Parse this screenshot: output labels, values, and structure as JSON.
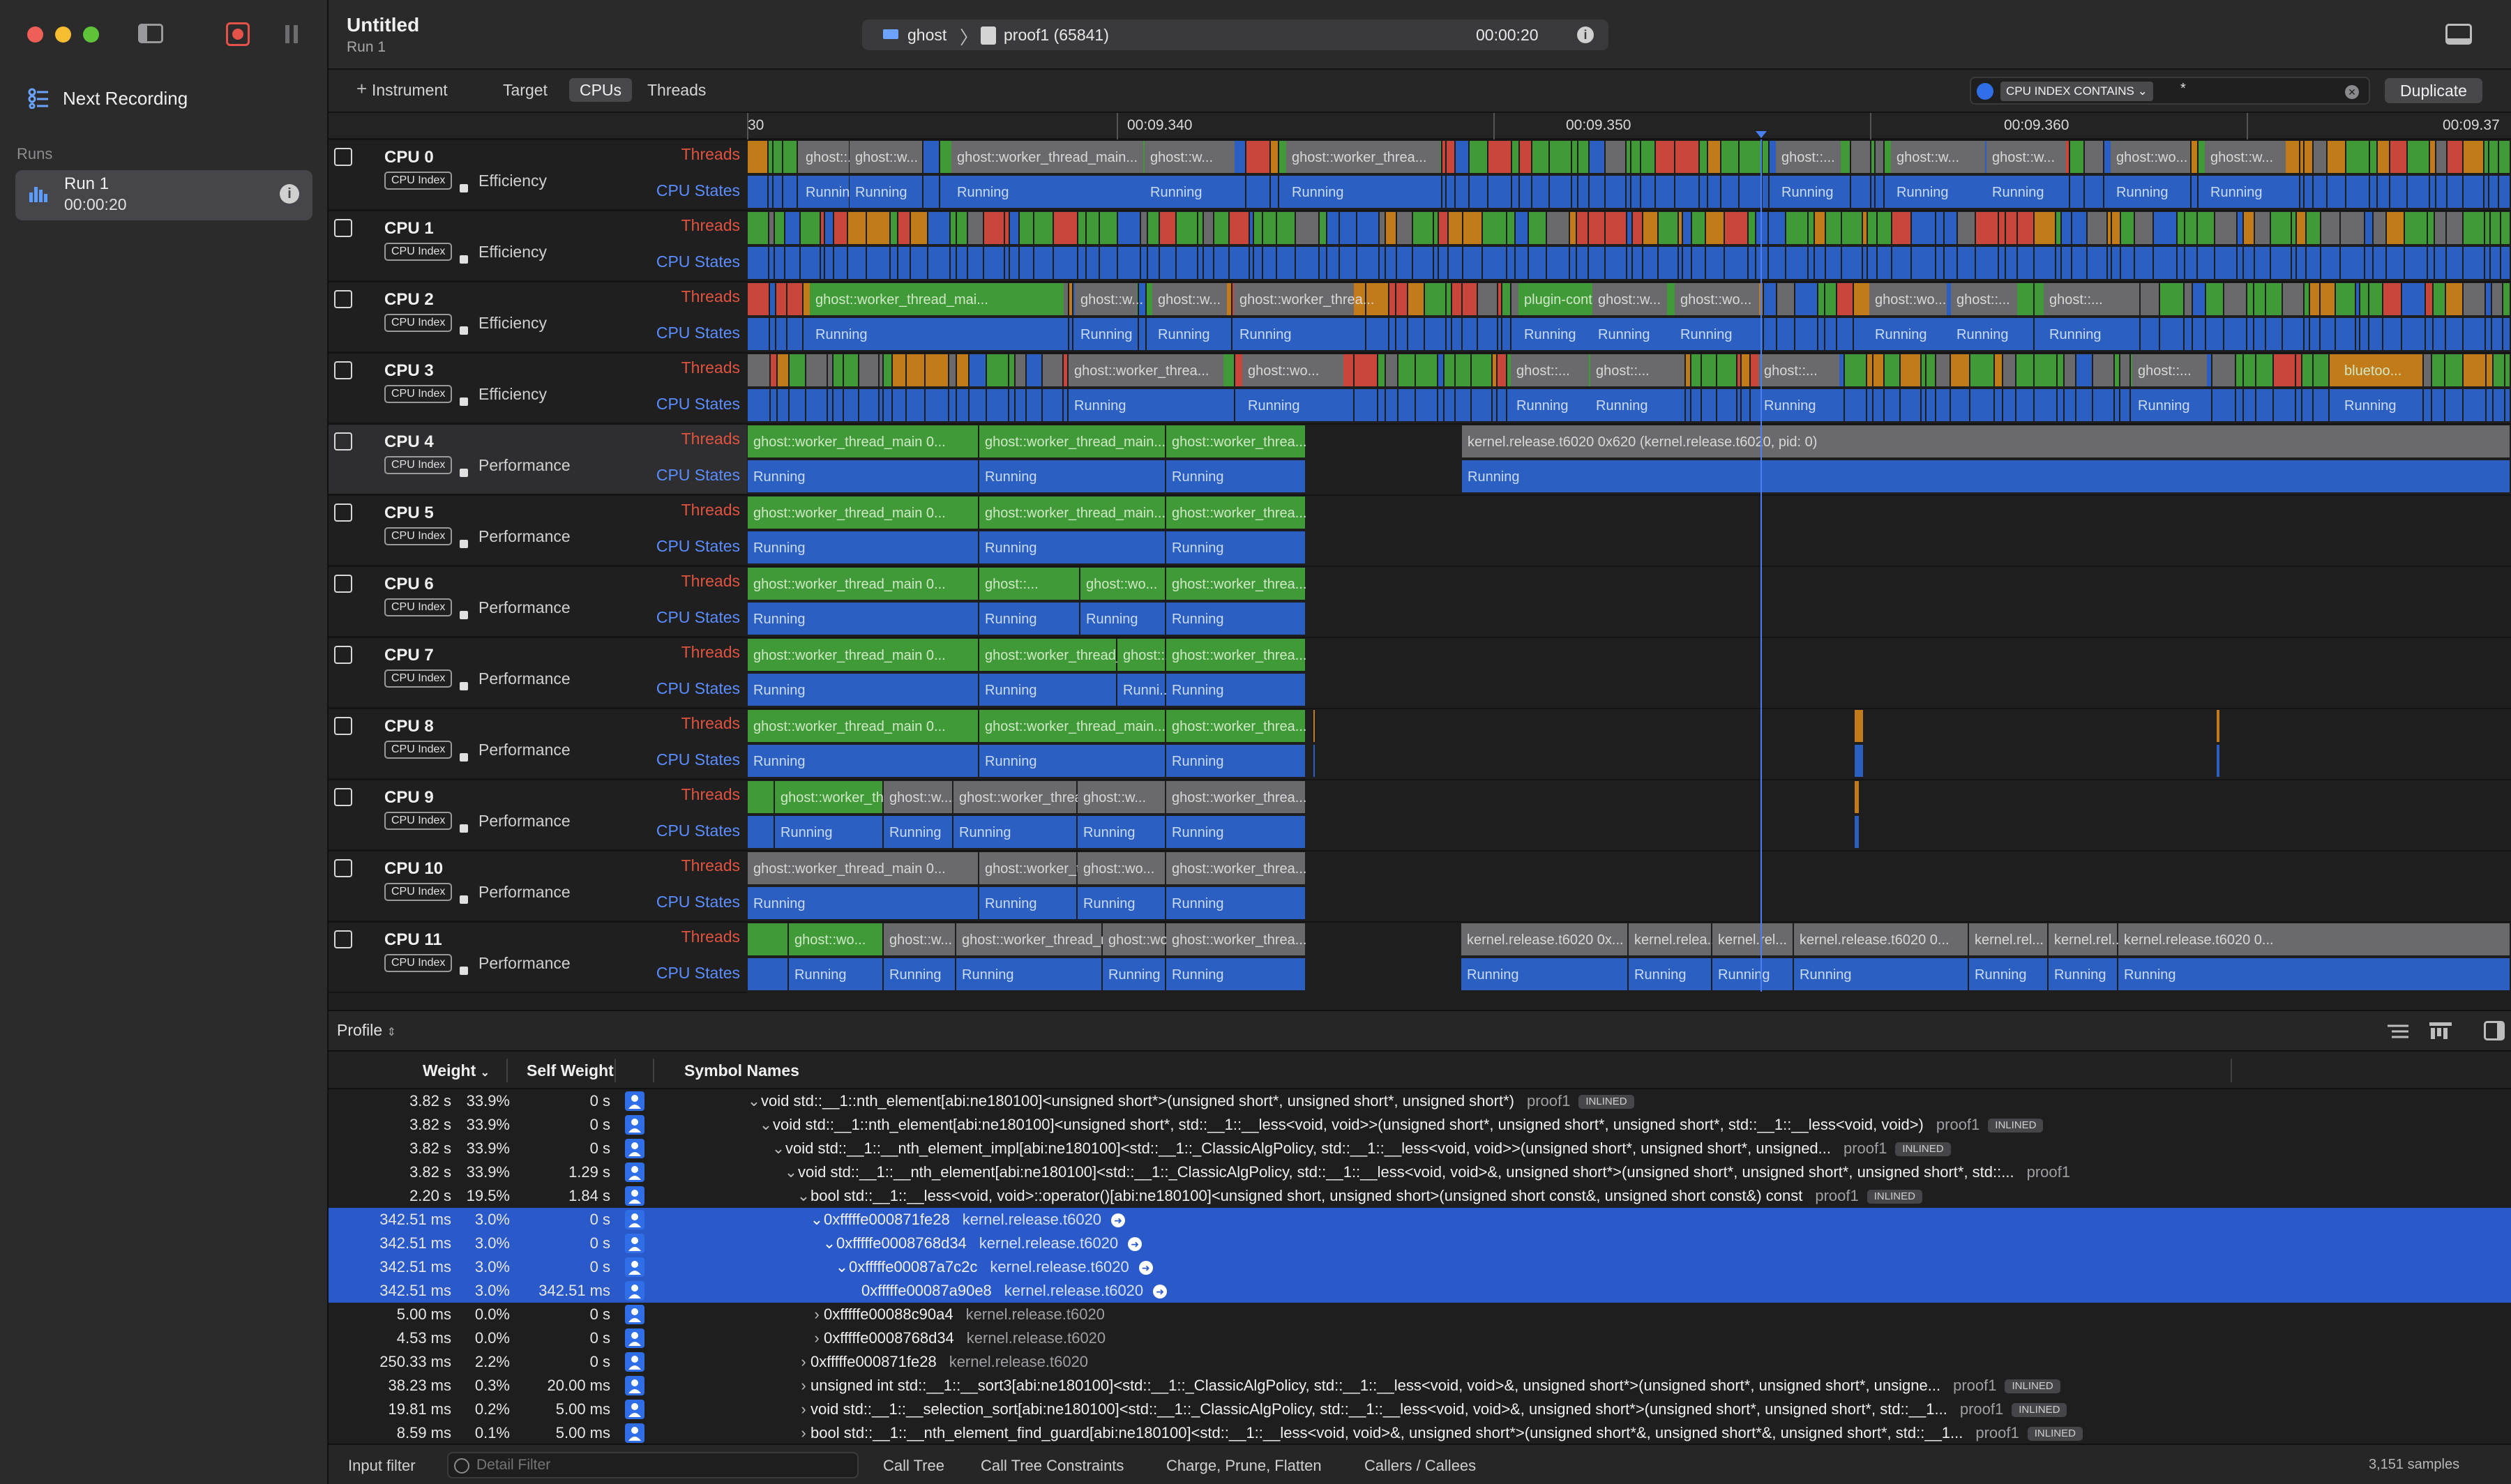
{
  "window": {
    "title": "Untitled",
    "subtitle": "Run 1"
  },
  "sidebar": {
    "next_recording": "Next Recording",
    "runs_header": "Runs",
    "run": {
      "name": "Run 1",
      "duration": "00:00:20"
    }
  },
  "toolbar": {
    "target_device": "ghost",
    "target_process": "proof1 (65841)",
    "elapsed": "00:00:20"
  },
  "filterbar": {
    "add_instrument": "Instrument",
    "tabs": [
      "Target",
      "CPUs",
      "Threads"
    ],
    "active_tab": "CPUs",
    "filter_token": "CPU INDEX CONTAINS",
    "filter_value": "*",
    "duplicate": "Duplicate"
  },
  "ruler": {
    "ticks": [
      "30",
      "00:09.340",
      "00:09.350",
      "00:09.360",
      "00:09.37"
    ]
  },
  "track_labels": {
    "threads": "Threads",
    "states": "CPU States",
    "cpu_index": "CPU Index"
  },
  "tracks": [
    {
      "name": "CPU 0",
      "kind": "Efficiency"
    },
    {
      "name": "CPU 1",
      "kind": "Efficiency"
    },
    {
      "name": "CPU 2",
      "kind": "Efficiency"
    },
    {
      "name": "CPU 3",
      "kind": "Efficiency"
    },
    {
      "name": "CPU 4",
      "kind": "Performance"
    },
    {
      "name": "CPU 5",
      "kind": "Performance"
    },
    {
      "name": "CPU 6",
      "kind": "Performance"
    },
    {
      "name": "CPU 7",
      "kind": "Performance"
    },
    {
      "name": "CPU 8",
      "kind": "Performance"
    },
    {
      "name": "CPU 9",
      "kind": "Performance"
    },
    {
      "name": "CPU 10",
      "kind": "Performance"
    },
    {
      "name": "CPU 11",
      "kind": "Performance"
    }
  ],
  "segment_texts": {
    "worker_main": "ghost::worker_thread_main  0...",
    "worker_main2": "ghost::worker_thread_main...",
    "worker_threa": "ghost::worker_threa...",
    "ghost_w": "ghost::w...",
    "ghost_wo": "ghost::wo...",
    "ghost_short": "ghost::...",
    "worker_thread_mai": "ghost::worker_thread_mai...",
    "plugin": "plugin-cont...",
    "bluetoo": "bluetoo...",
    "kernel_long": "kernel.release.t6020  0x620 (kernel.release.t6020, pid: 0)",
    "kernel": "kernel.release.t6020  0x...",
    "kernel_short": "kernel.relea...",
    "kernel_rel": "kernel.rel...",
    "kernel_mid": "kernel.release.t6020  0...",
    "running": "Running",
    "runni": "Runni..."
  },
  "profile": {
    "mode": "Profile",
    "columns": {
      "weight": "Weight",
      "self_weight": "Self Weight",
      "symbols": "Symbol Names"
    },
    "rows": [
      {
        "w": "3.82 s",
        "p": "33.9%",
        "self": "0 s",
        "sym": "void std::__1::nth_element[abi:ne180100]<unsigned short*>(unsigned short*, unsigned short*, unsigned short*)",
        "lib": "proof1",
        "badge": "INLINED",
        "sel": false
      },
      {
        "w": "3.82 s",
        "p": "33.9%",
        "self": "0 s",
        "sym": "void std::__1::nth_element[abi:ne180100]<unsigned short*, std::__1::__less<void, void>>(unsigned short*, unsigned short*, unsigned short*, std::__1::__less<void, void>)",
        "lib": "proof1",
        "badge": "INLINED",
        "sel": false
      },
      {
        "w": "3.82 s",
        "p": "33.9%",
        "self": "0 s",
        "sym": "void std::__1::__nth_element_impl[abi:ne180100]<std::__1::_ClassicAlgPolicy, std::__1::__less<void, void>>(unsigned short*, unsigned short*, unsigned...",
        "lib": "proof1",
        "badge": "INLINED",
        "sel": false
      },
      {
        "w": "3.82 s",
        "p": "33.9%",
        "self": "1.29 s",
        "sym": "void std::__1::__nth_element[abi:ne180100]<std::__1::_ClassicAlgPolicy, std::__1::__less<void, void>&, unsigned short*>(unsigned short*, unsigned short*, unsigned short*, std::...",
        "lib": "proof1",
        "badge": "",
        "sel": false
      },
      {
        "w": "2.20 s",
        "p": "19.5%",
        "self": "1.84 s",
        "sym": "bool std::__1::__less<void, void>::operator()[abi:ne180100]<unsigned short, unsigned short>(unsigned short const&, unsigned short const&) const",
        "lib": "proof1",
        "badge": "INLINED",
        "sel": false
      },
      {
        "w": "342.51 ms",
        "p": "3.0%",
        "self": "0 s",
        "sym": "0xfffffe000871fe28",
        "lib": "kernel.release.t6020",
        "badge": "",
        "sel": true
      },
      {
        "w": "342.51 ms",
        "p": "3.0%",
        "self": "0 s",
        "sym": "0xfffffe0008768d34",
        "lib": "kernel.release.t6020",
        "badge": "",
        "sel": true
      },
      {
        "w": "342.51 ms",
        "p": "3.0%",
        "self": "0 s",
        "sym": "0xfffffe00087a7c2c",
        "lib": "kernel.release.t6020",
        "badge": "",
        "sel": true
      },
      {
        "w": "342.51 ms",
        "p": "3.0%",
        "self": "342.51 ms",
        "sym": "0xfffffe00087a90e8",
        "lib": "kernel.release.t6020",
        "badge": "",
        "sel": true
      },
      {
        "w": "5.00 ms",
        "p": "0.0%",
        "self": "0 s",
        "sym": "0xfffffe00088c90a4",
        "lib": "kernel.release.t6020",
        "badge": "",
        "sel": false
      },
      {
        "w": "4.53 ms",
        "p": "0.0%",
        "self": "0 s",
        "sym": "0xfffffe0008768d34",
        "lib": "kernel.release.t6020",
        "badge": "",
        "sel": false
      },
      {
        "w": "250.33 ms",
        "p": "2.2%",
        "self": "0 s",
        "sym": "0xfffffe000871fe28",
        "lib": "kernel.release.t6020",
        "badge": "",
        "sel": false
      },
      {
        "w": "38.23 ms",
        "p": "0.3%",
        "self": "20.00 ms",
        "sym": "unsigned int std::__1::__sort3[abi:ne180100]<std::__1::_ClassicAlgPolicy, std::__1::__less<void, void>&, unsigned short*>(unsigned short*, unsigned short*, unsigne...",
        "lib": "proof1",
        "badge": "INLINED",
        "sel": false
      },
      {
        "w": "19.81 ms",
        "p": "0.2%",
        "self": "5.00 ms",
        "sym": "void std::__1::__selection_sort[abi:ne180100]<std::__1::_ClassicAlgPolicy, std::__1::__less<void, void>&, unsigned short*>(unsigned short*, unsigned short*, std::__1...",
        "lib": "proof1",
        "badge": "INLINED",
        "sel": false
      },
      {
        "w": "8.59 ms",
        "p": "0.1%",
        "self": "5.00 ms",
        "sym": "bool std::__1::__nth_element_find_guard[abi:ne180100]<std::__1::__less<void, void>&, unsigned short*>(unsigned short*&, unsigned short*&, unsigned short*, std::__1...",
        "lib": "proof1",
        "badge": "INLINED",
        "sel": false
      }
    ]
  },
  "bottombar": {
    "input_filter": "Input filter",
    "detail_placeholder": "Detail Filter",
    "buttons": [
      "Call Tree",
      "Call Tree Constraints",
      "Charge, Prune, Flatten",
      "Callers / Callees"
    ],
    "samples": "3,151 samples"
  },
  "colors": {
    "green": "#3f9a37",
    "gray": "#6a6a6c",
    "blue": "#2b5fc2",
    "orange": "#c27b19",
    "red": "#c8463a",
    "selection": "#2a59c9",
    "threads_label": "#e0533f",
    "states_label": "#5b8dff"
  }
}
